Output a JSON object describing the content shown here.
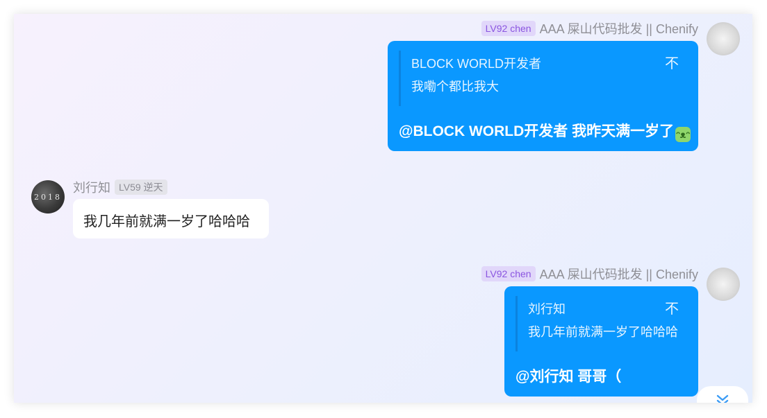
{
  "messages": [
    {
      "side": "right",
      "level_badge": "LV92 chen",
      "username": "AAA 屎山代码批发 || Chenify",
      "quote": {
        "name": "BLOCK WORLD开发者",
        "text": "我嘞个都比我大",
        "close": "不"
      },
      "text": "@BLOCK WORLD开发者 我昨天满一岁了"
    },
    {
      "side": "left",
      "avatar_text": "2018",
      "username": "刘行知",
      "level_badge": "LV59 逆天",
      "text": "我几年前就满一岁了哈哈哈"
    },
    {
      "side": "right",
      "level_badge": "LV92 chen",
      "username": "AAA 屎山代码批发 || Chenify",
      "quote": {
        "name": "刘行知",
        "text": "我几年前就满一岁了哈哈哈",
        "close": "不"
      },
      "text": "@刘行知 哥哥（"
    }
  ],
  "scroll_button": {
    "icon": "double-chevron-down-icon",
    "glyph": "⌄"
  },
  "colors": {
    "bubble_blue": "#0a98ff",
    "badge_purple_bg": "#e1d7fa",
    "badge_purple_fg": "#8a55e0",
    "accent": "#3b9cf5"
  }
}
